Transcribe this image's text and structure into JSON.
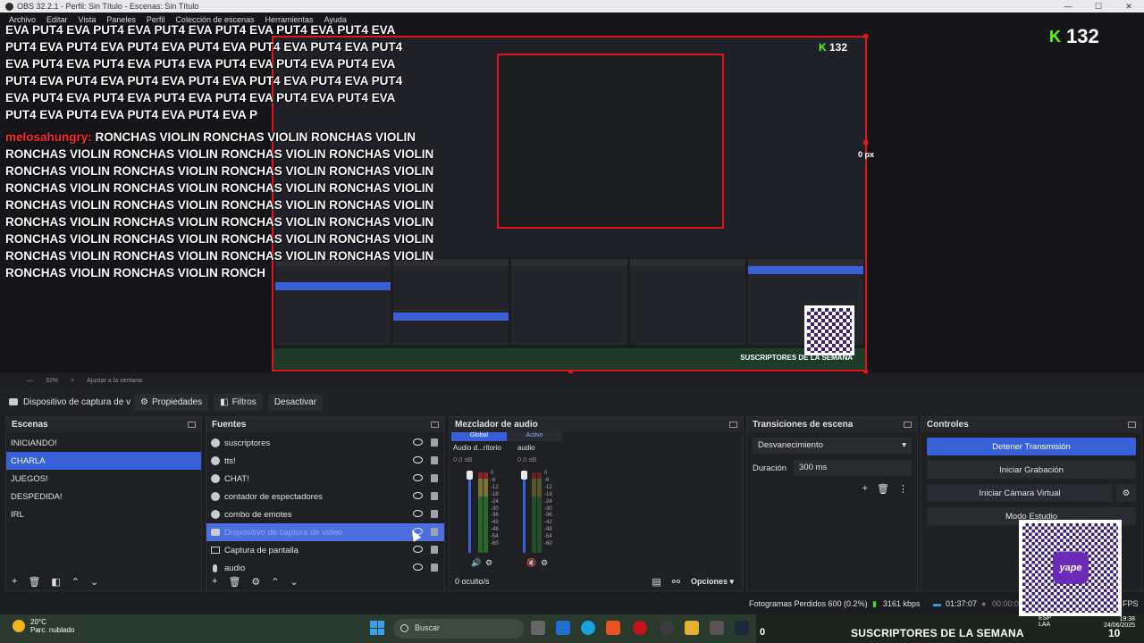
{
  "window": {
    "title": "OBS 32.2.1 - Perfil: Sin Título - Escenas: Sin Título",
    "menus": [
      "Archivo",
      "Editar",
      "Vista",
      "Paneles",
      "Perfil",
      "Colección de escenas",
      "Herramientas",
      "Ayuda"
    ]
  },
  "preview": {
    "chat_lines": [
      "EVA PUT4 EVA PUT4 EVA PUT4 EVA PUT4 EVA PUT4 EVA PUT4 EVA",
      "PUT4 EVA PUT4 EVA PUT4 EVA PUT4 EVA PUT4 EVA PUT4 EVA PUT4",
      "EVA PUT4 EVA PUT4 EVA PUT4 EVA PUT4 EVA PUT4 EVA PUT4 EVA",
      "PUT4 EVA PUT4 EVA PUT4 EVA PUT4 EVA PUT4 EVA PUT4 EVA PUT4",
      "EVA PUT4 EVA PUT4 EVA PUT4 EVA PUT4 EVA PUT4 EVA PUT4 EVA",
      "PUT4 EVA PUT4 EVA PUT4 EVA PUT4 EVA P"
    ],
    "chat_user": "melosahungry:",
    "chat_msg_lines": [
      "RONCHAS VIOLIN RONCHAS VIOLIN RONCHAS VIOLIN",
      "RONCHAS VIOLIN RONCHAS VIOLIN RONCHAS VIOLIN RONCHAS VIOLIN",
      "RONCHAS VIOLIN RONCHAS VIOLIN RONCHAS VIOLIN RONCHAS VIOLIN",
      "RONCHAS VIOLIN RONCHAS VIOLIN RONCHAS VIOLIN RONCHAS VIOLIN",
      "RONCHAS VIOLIN RONCHAS VIOLIN RONCHAS VIOLIN RONCHAS VIOLIN",
      "RONCHAS VIOLIN RONCHAS VIOLIN RONCHAS VIOLIN RONCHAS VIOLIN",
      "RONCHAS VIOLIN RONCHAS VIOLIN RONCHAS VIOLIN RONCHAS VIOLIN",
      "RONCHAS VIOLIN RONCHAS VIOLIN RONCHAS VIOLIN RONCHAS VIOLIN",
      "RONCHAS VIOLIN RONCHAS VIOLIN RONCH"
    ],
    "viewer_count": "132",
    "mini_viewer_count": "132",
    "px_label": "0 px",
    "zoom": "32%",
    "zoom_option": "Ajustar a la ventana",
    "inner_subs_text": "SUSCRIPTORES DE LA SEMANA"
  },
  "source_toolbar": {
    "selected_source": "Dispositivo de captura de v",
    "properties": "Propiedades",
    "filters": "Filtros",
    "deactivate": "Desactivar"
  },
  "scenes": {
    "title": "Escenas",
    "items": [
      "INICIANDO!",
      "CHARLA",
      "JUEGOS!",
      "DESPEDIDA!",
      "IRL"
    ],
    "selected": "CHARLA"
  },
  "sources": {
    "title": "Fuentes",
    "items": [
      {
        "label": "suscriptores",
        "icon": "browser-icon"
      },
      {
        "label": "tts!",
        "icon": "browser-icon"
      },
      {
        "label": "CHAT!",
        "icon": "browser-icon"
      },
      {
        "label": "contador de espectadores",
        "icon": "browser-icon"
      },
      {
        "label": "combo de emotes",
        "icon": "browser-icon"
      },
      {
        "label": "Dispositivo de captura de video",
        "icon": "camera-icon"
      },
      {
        "label": "Captura de pantalla",
        "icon": "monitor-icon"
      },
      {
        "label": "audio",
        "icon": "mic-icon"
      }
    ]
  },
  "mixer": {
    "title": "Mezclador de audio",
    "tab_global": "Global",
    "tab_active": "Activo",
    "channels": [
      {
        "name": "Audio d...ritorio",
        "db": "0.0 dB"
      },
      {
        "name": "audio",
        "db": "0.0 dB"
      }
    ],
    "scale": [
      "0",
      "-6",
      "-12",
      "-18",
      "-24",
      "-30",
      "-36",
      "-42",
      "-48",
      "-54",
      "-60"
    ],
    "hidden": "0 oculto/s",
    "options": "Opciones"
  },
  "transitions": {
    "title": "Transiciones de escena",
    "type": "Desvanecimiento",
    "duration_label": "Duración",
    "duration_value": "300 ms"
  },
  "controls": {
    "title": "Controles",
    "stop_stream": "Detener Transmisión",
    "start_record": "Iniciar Grabación",
    "virtual_cam": "Iniciar Cámara Virtual",
    "studio_mode": "Modo Estudio"
  },
  "status": {
    "dropped_frames": "Fotogramas Perdidos 600 (0.2%)",
    "bitrate": "3161 kbps",
    "stream_time": "01:37:07",
    "record_time": "00:00:00",
    "fps": "FPS"
  },
  "taskbar": {
    "temp": "20°C",
    "weather": "Parc. nublado",
    "search": "Buscar",
    "subs_banner": "SUSCRIPTORES DE LA SEMANA",
    "banner_left": "0",
    "banner_right": "10",
    "lang": "ESP",
    "lang2": "LAA",
    "time": "19:38",
    "date": "24/06/2025"
  },
  "qr_brand": "yape",
  "colors": {
    "accent": "#3760d9",
    "live_border": "#e0141c",
    "kick_green": "#53fc18"
  }
}
